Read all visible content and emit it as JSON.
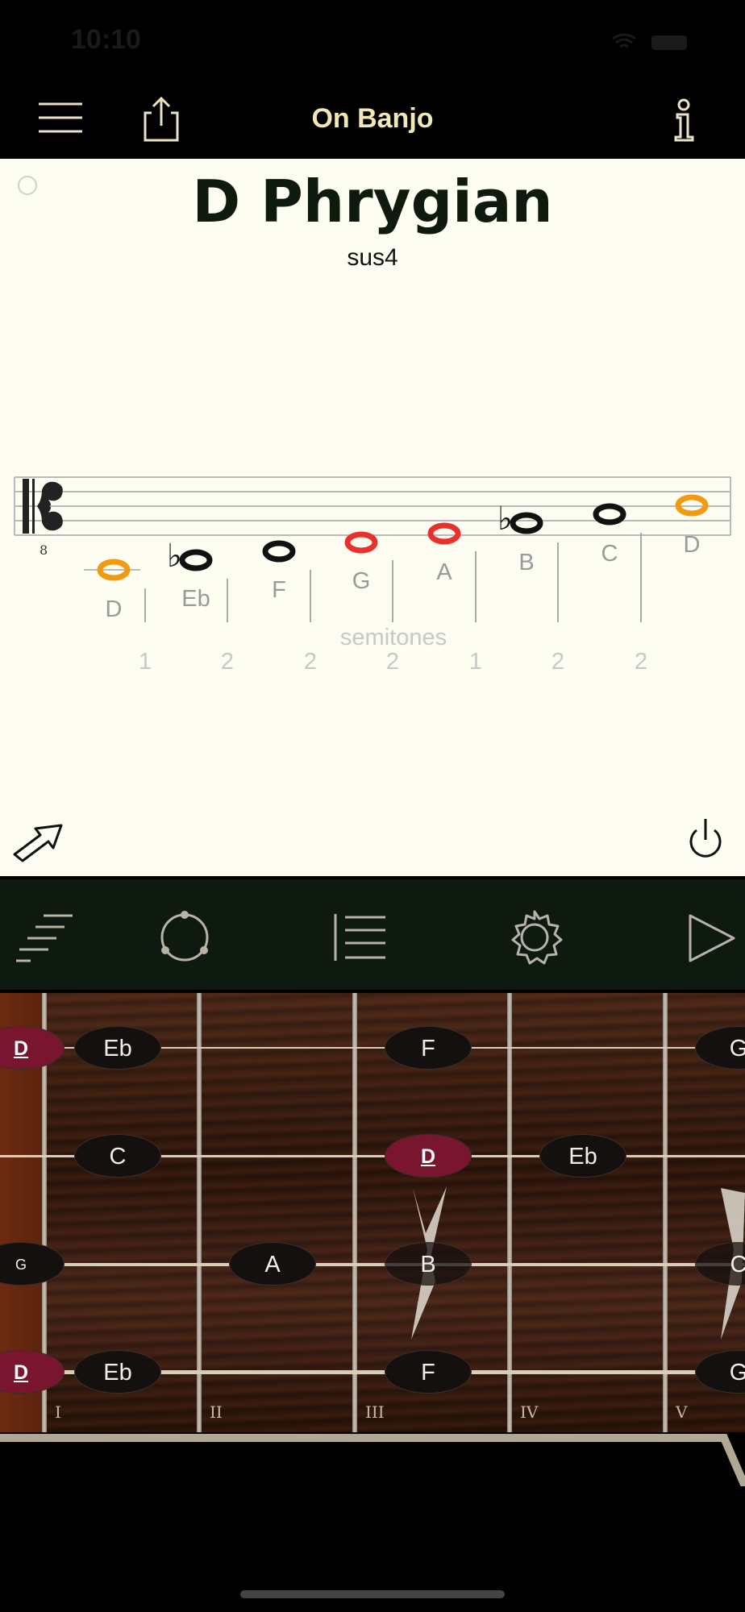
{
  "status_bar": {
    "time": "10:10"
  },
  "nav": {
    "title": "On Banjo",
    "menu_icon": "menu-icon",
    "share_icon": "share-icon",
    "info_icon": "info-icon"
  },
  "scale": {
    "title": "D Phrygian",
    "subtitle": "sus4",
    "notes": [
      {
        "label": "D",
        "accidental": "",
        "color": "#f29a12"
      },
      {
        "label": "Eb",
        "accidental": "♭",
        "color": "#111111"
      },
      {
        "label": "F",
        "accidental": "",
        "color": "#111111"
      },
      {
        "label": "G",
        "accidental": "",
        "color": "#e8302c"
      },
      {
        "label": "A",
        "accidental": "",
        "color": "#e8302c"
      },
      {
        "label": "B",
        "accidental": "♭",
        "color": "#111111"
      },
      {
        "label": "C",
        "accidental": "",
        "color": "#111111"
      },
      {
        "label": "D",
        "accidental": "",
        "color": "#f29a12"
      }
    ],
    "semitones_label": "semitones",
    "semitones": [
      "1",
      "2",
      "2",
      "2",
      "1",
      "2",
      "2"
    ]
  },
  "content_icons": {
    "expand": "expand-arrow-icon",
    "power": "power-icon"
  },
  "toolbar": [
    "scales-icon",
    "circle-icon",
    "list-icon",
    "gear-icon",
    "play-icon"
  ],
  "fretboard": {
    "fret_numbers": [
      "I",
      "II",
      "III",
      "IV",
      "V"
    ],
    "strings": [
      {
        "notes": [
          "D",
          "Eb",
          "F",
          "G"
        ]
      },
      {
        "notes": [
          "C",
          "D",
          "Eb"
        ]
      },
      {
        "notes": [
          "G",
          "A",
          "B",
          "C"
        ]
      },
      {
        "notes": [
          "D",
          "Eb",
          "F",
          "G"
        ]
      }
    ],
    "colors": {
      "root": "#7a1530",
      "note": "#151010"
    }
  }
}
